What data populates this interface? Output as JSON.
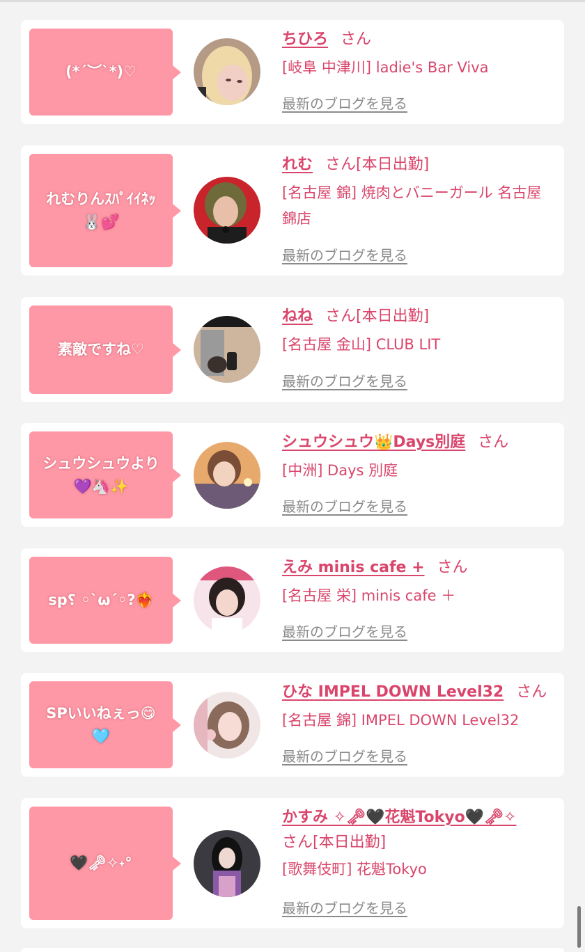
{
  "cards": [
    {
      "bubble": "(*´︶`*)♡",
      "name": "ちひろ",
      "san": "さん",
      "status": "",
      "shop": "[岐阜 中津川] ladie's Bar Viva",
      "blog": "最新のブログを見る",
      "avatar_icon": "profile-photo"
    },
    {
      "bubble": "れむりんｽﾊﾟｲｲﾈｯ\n🐰💕",
      "name": "れむ",
      "san": "さん",
      "status": "[本日出勤]",
      "shop": "[名古屋 錦] 焼肉とバニーガール 名古屋 錦店",
      "blog": "最新のブログを見る",
      "avatar_icon": "profile-photo"
    },
    {
      "bubble": "素敵ですね♡",
      "name": "ねね",
      "san": "さん",
      "status": "[本日出勤]",
      "shop": "[名古屋 金山] CLUB LIT",
      "blog": "最新のブログを見る",
      "avatar_icon": "profile-photo"
    },
    {
      "bubble": "シュウシュウより\n💜🦄✨",
      "name": "シュウシュウ👑Days別庭",
      "san": "さん",
      "status": "",
      "shop": "[中洲] Days 別庭",
      "blog": "最新のブログを見る",
      "avatar_icon": "profile-photo"
    },
    {
      "bubble": "sp؟ ◦`ω´◦?❤️‍🔥",
      "name": "えみ minis cafe +",
      "san": "さん",
      "status": "",
      "shop": "[名古屋 栄] minis cafe ＋",
      "blog": "最新のブログを見る",
      "avatar_icon": "profile-photo"
    },
    {
      "bubble": "SPいいねぇっ😋\n🩵",
      "name": "ひな IMPEL DOWN Level32",
      "san": "さん",
      "status": "",
      "shop": "[名古屋 錦] IMPEL DOWN Level32",
      "blog": "最新のブログを見る",
      "avatar_icon": "profile-photo"
    },
    {
      "bubble": "🖤🗝✧˖°",
      "name": "かすみ ✧🗝🖤花魁Tokyo🖤🗝✧",
      "san": "さん",
      "status": "[本日出勤]",
      "shop": "[歌舞伎町] 花魁Tokyo",
      "blog": "最新のブログを見る",
      "avatar_icon": "profile-photo"
    }
  ],
  "colors": {
    "accent": "#d9456b",
    "bubble": "#ff98a6",
    "background": "#f3f3f3",
    "card": "#ffffff",
    "link_gray": "#8a8a8a"
  }
}
